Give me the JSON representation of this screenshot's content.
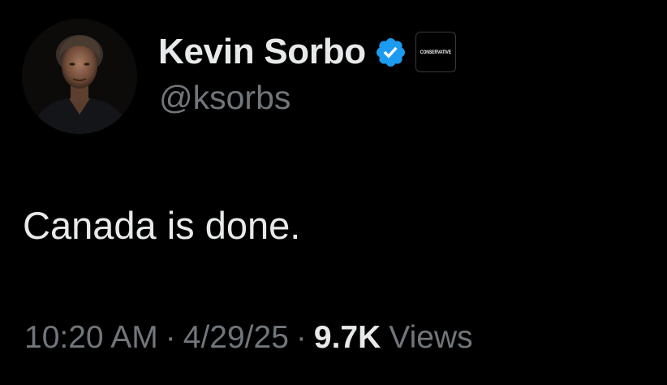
{
  "author": {
    "display_name": "Kevin Sorbo",
    "handle": "@ksorbs",
    "verified_badge_color": "#1d9bf0",
    "affiliation_label": "CONSERVATIVE"
  },
  "tweet": {
    "text": "Canada is done."
  },
  "meta": {
    "time": "10:20 AM",
    "separator": "·",
    "date": "4/29/25",
    "views_count": "9.7K",
    "views_label": "Views"
  },
  "colors": {
    "background": "#000000",
    "primary_text": "#e7e9ea",
    "secondary_text": "#71767b",
    "accent": "#1d9bf0"
  }
}
